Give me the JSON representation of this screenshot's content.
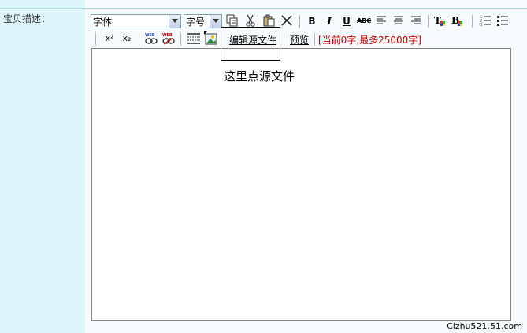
{
  "form": {
    "label": "宝贝描述："
  },
  "toolbar": {
    "font_select": "字体",
    "size_select": "字号",
    "bold": "B",
    "italic": "I",
    "underline": "U",
    "strike": "ABC",
    "superscript": "x²",
    "subscript": "x₂",
    "source_button": "编辑源文件",
    "preview_button": "预览",
    "char_count": "[当前0字,最多25000字]"
  },
  "annotation": {
    "text": "这里点源文件"
  },
  "watermark": "Clzhu521.51.com"
}
